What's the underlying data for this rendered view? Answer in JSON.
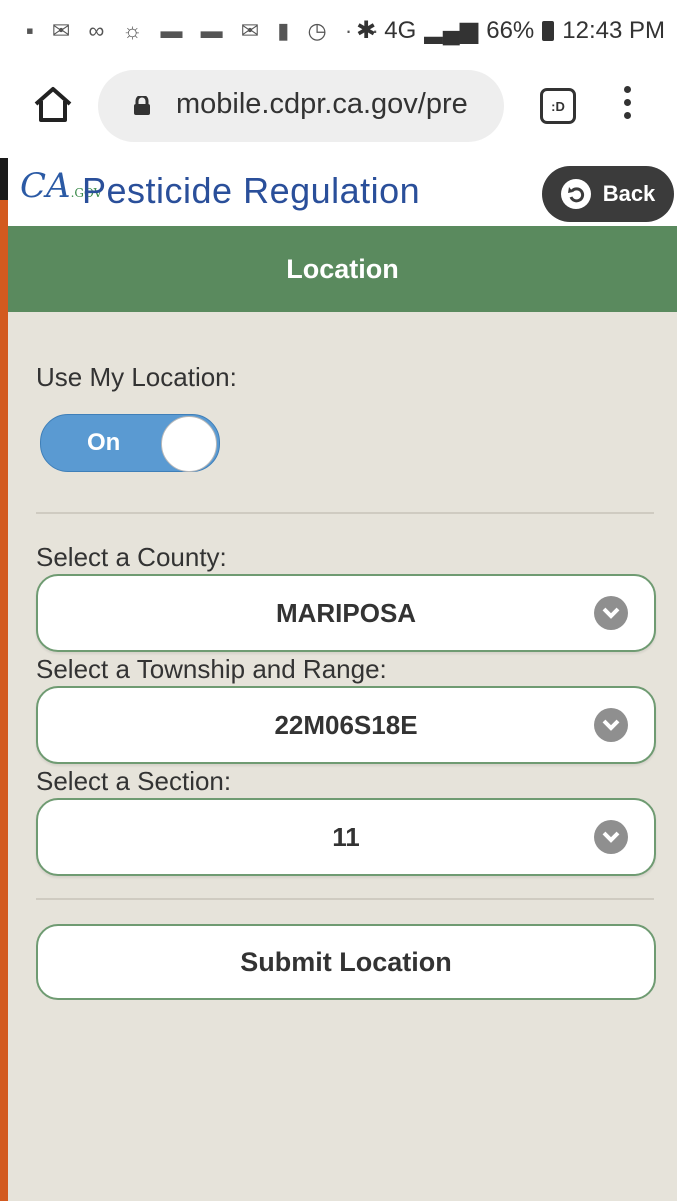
{
  "status_bar": {
    "left_icons": [
      "notification-icons"
    ],
    "battery_percent": "66%",
    "time": "12:43 PM",
    "network": "4G"
  },
  "browser": {
    "url": "mobile.cdpr.ca.gov/pre",
    "tabs_label": ":D"
  },
  "site": {
    "logo_text": "CA",
    "logo_sub": ".GOV",
    "title": "Pesticide Regulation",
    "back_label": "Back"
  },
  "page": {
    "title": "Location"
  },
  "form": {
    "use_location_label": "Use My Location:",
    "toggle_state": "On",
    "county_label": "Select a County:",
    "county_value": "MARIPOSA",
    "township_label": "Select a Township and Range:",
    "township_value": "22M06S18E",
    "section_label": "Select a Section:",
    "section_value": "11",
    "submit_label": "Submit Location"
  },
  "colors": {
    "header_green": "#5a8a5e",
    "toggle_blue": "#5a9ad2",
    "background": "#e6e3da"
  }
}
